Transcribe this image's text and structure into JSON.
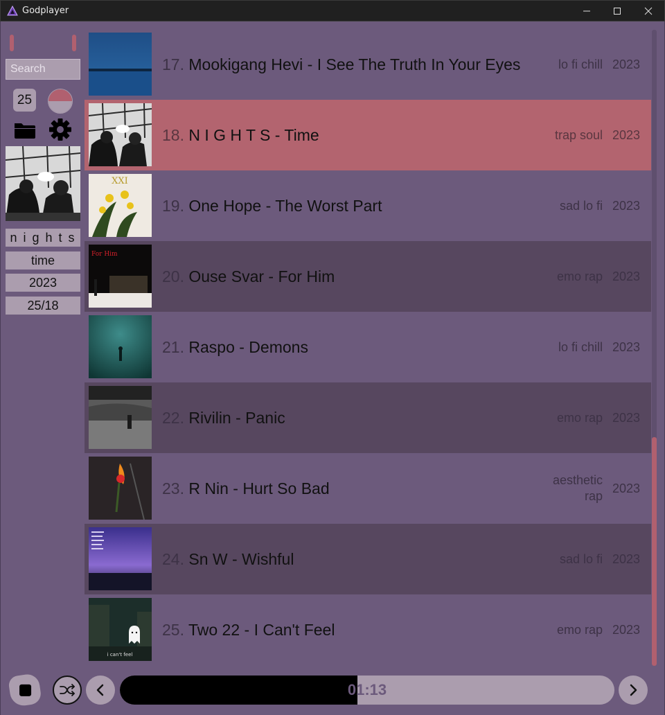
{
  "app": {
    "title": "Godplayer",
    "accent": "#b1606f",
    "bg": "#6c5a7c"
  },
  "window_controls": {
    "minimize": "minimize-icon",
    "maximize": "maximize-icon",
    "close": "close-icon"
  },
  "sidebar": {
    "search_placeholder": "Search",
    "volume": "25",
    "icons": [
      "folder-icon",
      "gear-icon"
    ],
    "now_playing": {
      "artist": "n i g h t s",
      "title": "time",
      "year": "2023",
      "position": "25/18"
    }
  },
  "tracks": [
    {
      "num": "17.",
      "title": "Mookigang Hevi - I See The Truth In Your Eyes",
      "genre": "lo fi chill",
      "year": "2023",
      "style": "normal"
    },
    {
      "num": "18.",
      "title": "N I G H T S - Time",
      "genre": "trap soul",
      "year": "2023",
      "style": "active"
    },
    {
      "num": "19.",
      "title": "One Hope - The Worst Part",
      "genre": "sad lo fi",
      "year": "2023",
      "style": "normal"
    },
    {
      "num": "20.",
      "title": "Ouse Svar - For Him",
      "genre": "emo rap",
      "year": "2023",
      "style": "dark"
    },
    {
      "num": "21.",
      "title": "Raspo - Demons",
      "genre": "lo fi chill",
      "year": "2023",
      "style": "normal"
    },
    {
      "num": "22.",
      "title": "Rivilin - Panic",
      "genre": "emo rap",
      "year": "2023",
      "style": "dark"
    },
    {
      "num": "23.",
      "title": "R Nin - Hurt So Bad",
      "genre": "aesthetic rap",
      "year": "2023",
      "style": "normal"
    },
    {
      "num": "24.",
      "title": "Sn W - Wishful",
      "genre": "sad lo fi",
      "year": "2023",
      "style": "dark"
    },
    {
      "num": "25.",
      "title": "Two 22 - I Can't Feel",
      "genre": "emo rap",
      "year": "2023",
      "style": "normal"
    }
  ],
  "cover_text": {
    "19": "XXI",
    "20": "For Him",
    "25": "i can't feel"
  },
  "player": {
    "time": "01:13",
    "progress": 0.48,
    "icons": [
      "stop-icon",
      "shuffle-icon",
      "previous-icon",
      "next-icon"
    ]
  }
}
